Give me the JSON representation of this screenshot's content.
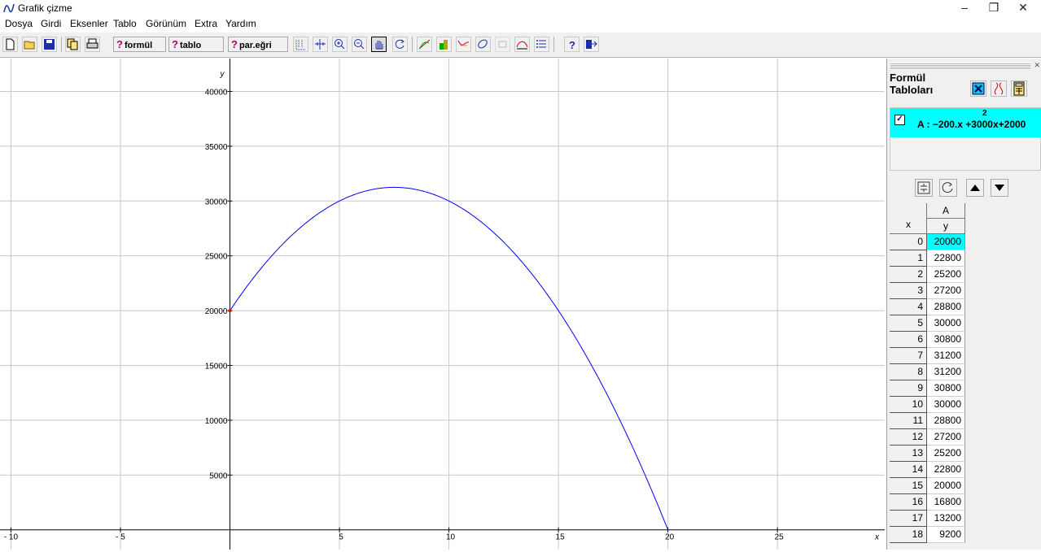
{
  "window": {
    "title": "Grafik çizme",
    "minimize": "–",
    "restore": "❐",
    "close": "✕"
  },
  "menu": [
    "Dosya",
    "Girdi",
    "Eksenler",
    "Tablo",
    "Görünüm",
    "Extra",
    "Yardım"
  ],
  "toolbar": {
    "formul_label": "formül",
    "tablo_label": "tablo",
    "paregri_label": "par.eğri",
    "q": "?"
  },
  "graph": {
    "x_axis_label": "x",
    "y_axis_label": "y",
    "x_ticks": [
      "- 10",
      "- 5",
      "5",
      "10",
      "15",
      "20",
      "25"
    ],
    "y_ticks": [
      "5000",
      "10000",
      "15000",
      "20000",
      "25000",
      "30000",
      "35000",
      "40000"
    ]
  },
  "side_panel": {
    "title_line1": "Formül",
    "title_line2": "Tabloları",
    "formula_label": "A : −200.x +3000x+2000",
    "formula_exponent": "2",
    "formula_checked": "☑",
    "table_header_name": "A",
    "table_header_x": "x",
    "table_header_y": "y",
    "rows": [
      {
        "x": "0",
        "y": "20000"
      },
      {
        "x": "1",
        "y": "22800"
      },
      {
        "x": "2",
        "y": "25200"
      },
      {
        "x": "3",
        "y": "27200"
      },
      {
        "x": "4",
        "y": "28800"
      },
      {
        "x": "5",
        "y": "30000"
      },
      {
        "x": "6",
        "y": "30800"
      },
      {
        "x": "7",
        "y": "31200"
      },
      {
        "x": "8",
        "y": "31200"
      },
      {
        "x": "9",
        "y": "30800"
      },
      {
        "x": "10",
        "y": "30000"
      },
      {
        "x": "11",
        "y": "28800"
      },
      {
        "x": "12",
        "y": "27200"
      },
      {
        "x": "13",
        "y": "25200"
      },
      {
        "x": "14",
        "y": "22800"
      },
      {
        "x": "15",
        "y": "20000"
      },
      {
        "x": "16",
        "y": "16800"
      },
      {
        "x": "17",
        "y": "13200"
      },
      {
        "x": "18",
        "y": "9200"
      }
    ]
  },
  "chart_data": {
    "type": "line",
    "xlabel": "x",
    "ylabel": "y",
    "xlim": [
      -10.5,
      29.9
    ],
    "ylim": [
      -1800,
      43000
    ],
    "function": {
      "a": -200,
      "b": 3000,
      "c": 20000,
      "domain": [
        0,
        20
      ]
    },
    "series": [
      {
        "name": "A",
        "color": "#0000ff"
      }
    ],
    "marked_point": {
      "x": 0,
      "y": 20000,
      "color": "#ff0000"
    },
    "grid": true
  },
  "colors": {
    "curve": "#0000ff",
    "highlight": "#00ffff",
    "grid": "#c8c8c8"
  }
}
